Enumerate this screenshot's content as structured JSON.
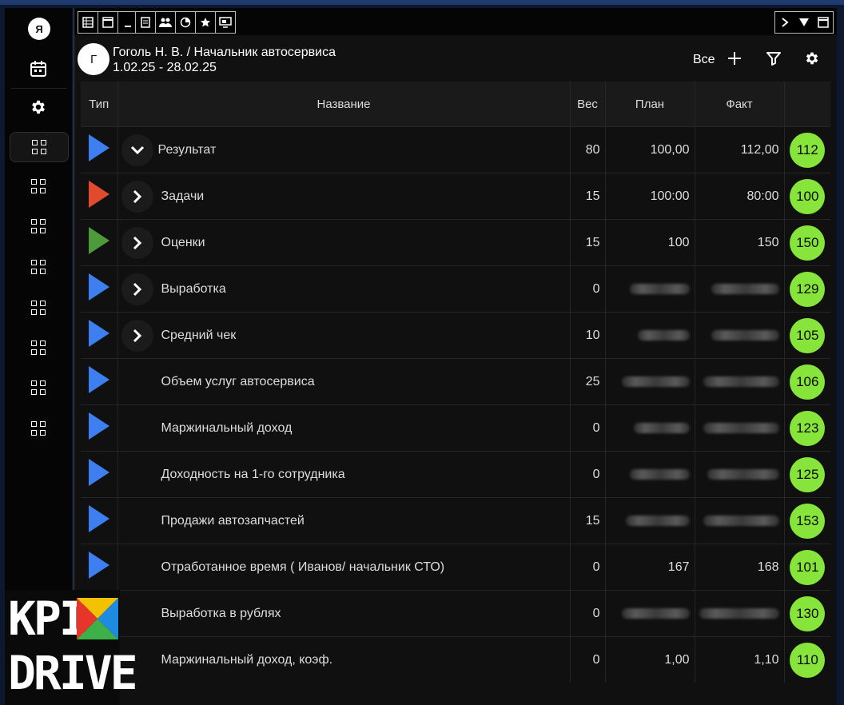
{
  "sidebar": {
    "avatar_letter": "Я",
    "icons": [
      "calendar-icon",
      "gear-icon",
      "grid-icon"
    ]
  },
  "header": {
    "avatar_letter": "Г",
    "title": "Гоголь Н. В. / Начальник автосервиса",
    "period": "1.02.25 - 28.02.25",
    "filter_all": "Все"
  },
  "table": {
    "columns": [
      "Тип",
      "Название",
      "Вес",
      "План",
      "Факт",
      ""
    ],
    "rows": [
      {
        "type_color": "#3d7ff0",
        "chevron": "down",
        "name": "Результат",
        "weight": "80",
        "plan": "100,00",
        "fact": "112,00",
        "score": "112"
      },
      {
        "type_color": "#e04b2d",
        "chevron": "right",
        "name": "Задачи",
        "weight": "15",
        "plan": "100:00",
        "fact": "80:00",
        "score": "100"
      },
      {
        "type_color": "#4c9a3a",
        "chevron": "right",
        "name": "Оценки",
        "weight": "15",
        "plan": "100",
        "fact": "150",
        "score": "150"
      },
      {
        "type_color": "#3d7ff0",
        "chevron": "right",
        "name": "Выработка",
        "weight": "0",
        "plan": null,
        "fact": null,
        "score": "129"
      },
      {
        "type_color": "#3d7ff0",
        "chevron": "right",
        "name": "Средний чек",
        "weight": "10",
        "plan": null,
        "fact": null,
        "score": "105"
      },
      {
        "type_color": "#3d7ff0",
        "chevron": "none",
        "name": "Объем услуг автосервиса",
        "weight": "25",
        "plan": null,
        "fact": null,
        "score": "106"
      },
      {
        "type_color": "#3d7ff0",
        "chevron": "none",
        "name": "Маржинальный доход",
        "weight": "0",
        "plan": null,
        "fact": null,
        "score": "123"
      },
      {
        "type_color": "#3d7ff0",
        "chevron": "none",
        "name": "Доходность на 1-го сотрудника",
        "weight": "0",
        "plan": null,
        "fact": null,
        "score": "125"
      },
      {
        "type_color": "#3d7ff0",
        "chevron": "none",
        "name": "Продажи автозапчастей",
        "weight": "15",
        "plan": null,
        "fact": null,
        "score": "153"
      },
      {
        "type_color": "#3d7ff0",
        "chevron": "none",
        "name": "Отработанное время ( Иванов/ начальник СТО)",
        "weight": "0",
        "plan": "167",
        "fact": "168",
        "score": "101"
      },
      {
        "type_color": null,
        "chevron": "none",
        "name": "Выработка в рублях",
        "weight": "0",
        "plan": null,
        "fact": null,
        "score": "130"
      },
      {
        "type_color": null,
        "chevron": "none",
        "name": "Маржинальный доход, коэф.",
        "weight": "0",
        "plan": "1,00",
        "fact": "1,10",
        "score": "110"
      }
    ]
  },
  "logo": {
    "line1": "KPI",
    "line2": "DRIVE"
  },
  "colors": {
    "score_bg": "#86e43a",
    "accent_blue": "#3d7ff0"
  }
}
